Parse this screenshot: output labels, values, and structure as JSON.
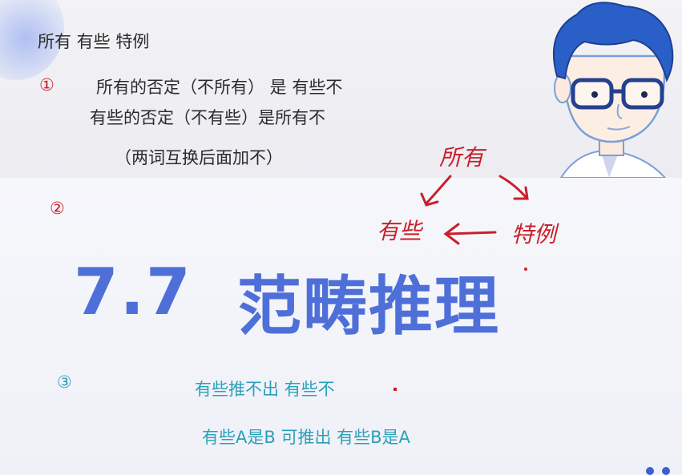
{
  "slide": {
    "heading": "所有   有些  特例",
    "item1_marker": "①",
    "item1_line1": "所有的否定（不所有） 是 有些不",
    "item1_line2": "有些的否定（不有些）是所有不",
    "item1_note": "（两词互换后面加不）",
    "item2_marker": "②",
    "title_number": "7.7",
    "title_text": "范畴推理",
    "item3_marker": "③",
    "item3_line1": "有些推不出 有些不",
    "item3_line2": "有些A是B  可推出  有些B是A"
  },
  "annotation": {
    "top_word": "所有",
    "left_word": "有些",
    "right_word": "特例",
    "ink_color": "#c8202a"
  },
  "colors": {
    "title": "#4f6fd8",
    "marker_red": "#c8202a",
    "teal_text": "#2aa0b8",
    "body_text": "#2b2b2b"
  }
}
